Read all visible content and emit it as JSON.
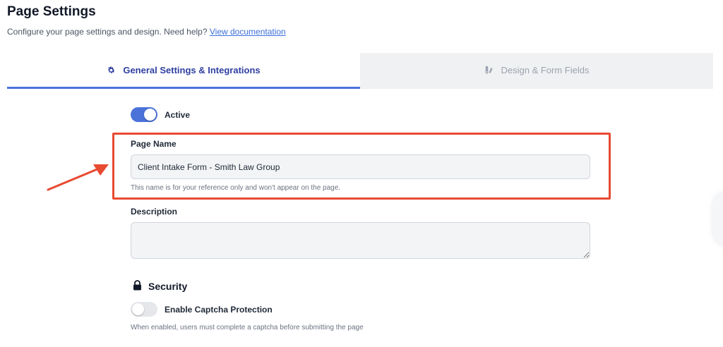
{
  "header": {
    "title": "Page Settings",
    "subtitle": "Configure your page settings and design. Need help?",
    "doc_link": "View documentation"
  },
  "tabs": [
    {
      "label": "General Settings & Integrations",
      "icon": "gear-icon",
      "active": true
    },
    {
      "label": "Design & Form Fields",
      "icon": "design-icon",
      "active": false
    }
  ],
  "active_toggle": {
    "label": "Active",
    "on": true
  },
  "page_name": {
    "label": "Page Name",
    "value": "Client Intake Form - Smith Law Group",
    "helper": "This name is for your reference only and won't appear on the page."
  },
  "description": {
    "label": "Description",
    "value": ""
  },
  "security": {
    "title": "Security",
    "icon": "lock-icon",
    "captcha_label": "Enable Captcha Protection",
    "captcha_on": false,
    "helper": "When enabled, users must complete a captcha before submitting the page"
  },
  "colors": {
    "accent": "#4a72d9",
    "tab_active_text": "#2f3fa0",
    "highlight": "#e84a32",
    "link": "#3b6fd8"
  }
}
